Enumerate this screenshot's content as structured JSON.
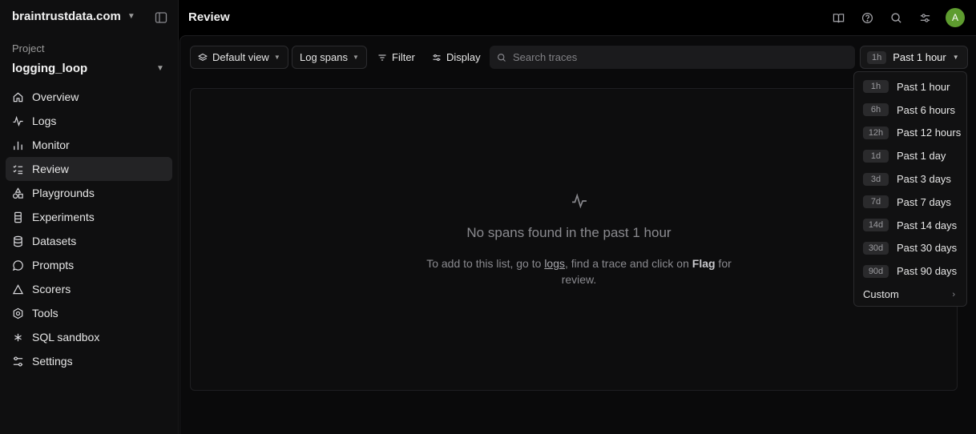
{
  "org": {
    "name": "braintrustdata.com"
  },
  "project": {
    "label": "Project",
    "name": "logging_loop"
  },
  "nav": [
    {
      "label": "Overview",
      "icon": "home-icon"
    },
    {
      "label": "Logs",
      "icon": "activity-icon"
    },
    {
      "label": "Monitor",
      "icon": "bar-chart-icon"
    },
    {
      "label": "Review",
      "icon": "list-check-icon",
      "active": true
    },
    {
      "label": "Playgrounds",
      "icon": "shapes-icon"
    },
    {
      "label": "Experiments",
      "icon": "flask-icon"
    },
    {
      "label": "Datasets",
      "icon": "database-icon"
    },
    {
      "label": "Prompts",
      "icon": "message-icon"
    },
    {
      "label": "Scorers",
      "icon": "triangle-icon"
    },
    {
      "label": "Tools",
      "icon": "hexagon-icon"
    },
    {
      "label": "SQL sandbox",
      "icon": "asterisk-icon"
    },
    {
      "label": "Settings",
      "icon": "sliders-icon"
    }
  ],
  "header": {
    "title": "Review",
    "avatar_initial": "A"
  },
  "toolbar": {
    "view_label": "Default view",
    "spans_label": "Log spans",
    "filter_label": "Filter",
    "display_label": "Display",
    "search_placeholder": "Search traces",
    "range_short": "1h",
    "range_label": "Past 1 hour"
  },
  "empty": {
    "title": "No spans found in the past 1 hour",
    "sub_pre": "To add to this list, go to ",
    "sub_link": "logs",
    "sub_mid": ", find a trace and click on ",
    "sub_bold": "Flag",
    "sub_post": " for review."
  },
  "time_menu": {
    "items": [
      {
        "short": "1h",
        "label": "Past 1 hour"
      },
      {
        "short": "6h",
        "label": "Past 6 hours"
      },
      {
        "short": "12h",
        "label": "Past 12 hours"
      },
      {
        "short": "1d",
        "label": "Past 1 day"
      },
      {
        "short": "3d",
        "label": "Past 3 days"
      },
      {
        "short": "7d",
        "label": "Past 7 days"
      },
      {
        "short": "14d",
        "label": "Past 14 days"
      },
      {
        "short": "30d",
        "label": "Past 30 days"
      },
      {
        "short": "90d",
        "label": "Past 90 days"
      }
    ],
    "custom_label": "Custom"
  },
  "colors": {
    "avatar": "#5e9c2f",
    "active_nav_bg": "#232325"
  }
}
